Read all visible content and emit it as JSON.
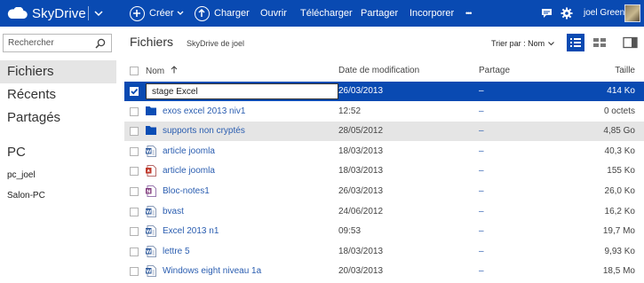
{
  "topbar": {
    "brand": "SkyDrive",
    "commands": [
      {
        "label": "Créer"
      },
      {
        "label": "Charger"
      },
      {
        "label": "Ouvrir"
      },
      {
        "label": "Télécharger"
      },
      {
        "label": "Partager"
      },
      {
        "label": "Incorporer"
      },
      {
        "label": "•••"
      }
    ],
    "user": "joel Green",
    "icons": [
      "cloud-icon",
      "chevron-down-icon",
      "plus-circle-icon",
      "upload-circle-icon",
      "chat-icon",
      "gear-icon",
      "help-icon",
      "avatar"
    ]
  },
  "sidebar": {
    "search_placeholder": "Rechercher",
    "items": [
      {
        "label": "Fichiers",
        "active": true
      },
      {
        "label": "Récents"
      },
      {
        "label": "Partagés"
      }
    ],
    "group_label": "PC",
    "pcs": [
      {
        "label": "pc_joel"
      },
      {
        "label": "Salon-PC"
      }
    ]
  },
  "content": {
    "title": "Fichiers",
    "subtitle": "SkyDrive de joel",
    "sort_label": "Trier par : Nom",
    "columns": {
      "name": "Nom",
      "modified": "Date de modification",
      "sharing": "Partage",
      "size": "Taille"
    },
    "rows": [
      {
        "name": "stage Excel",
        "date": "26/03/2013",
        "sharing": "–",
        "size": "414 Ko",
        "type": "editing",
        "state": "selected"
      },
      {
        "name": "exos excel 2013 niv1",
        "date": "12:52",
        "sharing": "–",
        "size": "0 octets",
        "type": "folder",
        "state": "normal"
      },
      {
        "name": "supports non cryptés",
        "date": "28/05/2012",
        "sharing": "–",
        "size": "4,85 Go",
        "type": "folder",
        "state": "hover"
      },
      {
        "name": "article joomla",
        "date": "18/03/2013",
        "sharing": "–",
        "size": "40,3 Ko",
        "type": "word",
        "state": "normal"
      },
      {
        "name": "article joomla",
        "date": "18/03/2013",
        "sharing": "–",
        "size": "155 Ko",
        "type": "pdf",
        "state": "normal"
      },
      {
        "name": "Bloc-notes1",
        "date": "26/03/2013",
        "sharing": "–",
        "size": "26,0 Ko",
        "type": "onenote",
        "state": "normal"
      },
      {
        "name": "bvast",
        "date": "24/06/2012",
        "sharing": "–",
        "size": "16,2 Ko",
        "type": "word",
        "state": "normal"
      },
      {
        "name": "Excel 2013 n1",
        "date": "09:53",
        "sharing": "–",
        "size": "19,7 Mo",
        "type": "word",
        "state": "normal"
      },
      {
        "name": "lettre 5",
        "date": "18/03/2013",
        "sharing": "–",
        "size": "9,93 Ko",
        "type": "word",
        "state": "normal"
      },
      {
        "name": "Windows eight niveau 1a",
        "date": "20/03/2013",
        "sharing": "–",
        "size": "18,5 Mo",
        "type": "word",
        "state": "normal"
      }
    ]
  },
  "colors": {
    "accent": "#094ab2",
    "link": "#2a5db0",
    "hover_row": "#e5e5e5"
  }
}
